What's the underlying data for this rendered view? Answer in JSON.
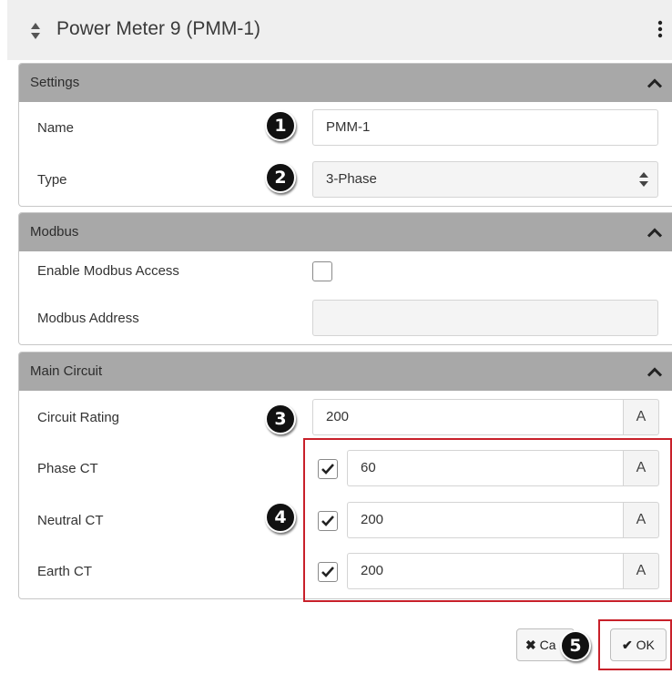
{
  "header": {
    "title": "Power Meter 9 (PMM-1)"
  },
  "settings": {
    "title": "Settings",
    "name_label": "Name",
    "name_value": "PMM-1",
    "type_label": "Type",
    "type_value": "3-Phase"
  },
  "modbus": {
    "title": "Modbus",
    "enable_label": "Enable Modbus Access",
    "enable_checked": false,
    "address_label": "Modbus Address",
    "address_value": ""
  },
  "main_circuit": {
    "title": "Main Circuit",
    "rows": [
      {
        "label": "Circuit Rating",
        "value": "200",
        "unit": "A"
      },
      {
        "label": "Phase CT",
        "value": "60",
        "unit": "A",
        "checked": true
      },
      {
        "label": "Neutral CT",
        "value": "200",
        "unit": "A",
        "checked": true
      },
      {
        "label": "Earth CT",
        "value": "200",
        "unit": "A",
        "checked": true
      }
    ]
  },
  "markers": [
    "1",
    "2",
    "3",
    "4",
    "5"
  ],
  "footer": {
    "cancel_label": "Ca",
    "ok_label": "OK"
  },
  "colors": {
    "panel_header": "#a8a8a8",
    "annotation_red": "#c8202a"
  }
}
